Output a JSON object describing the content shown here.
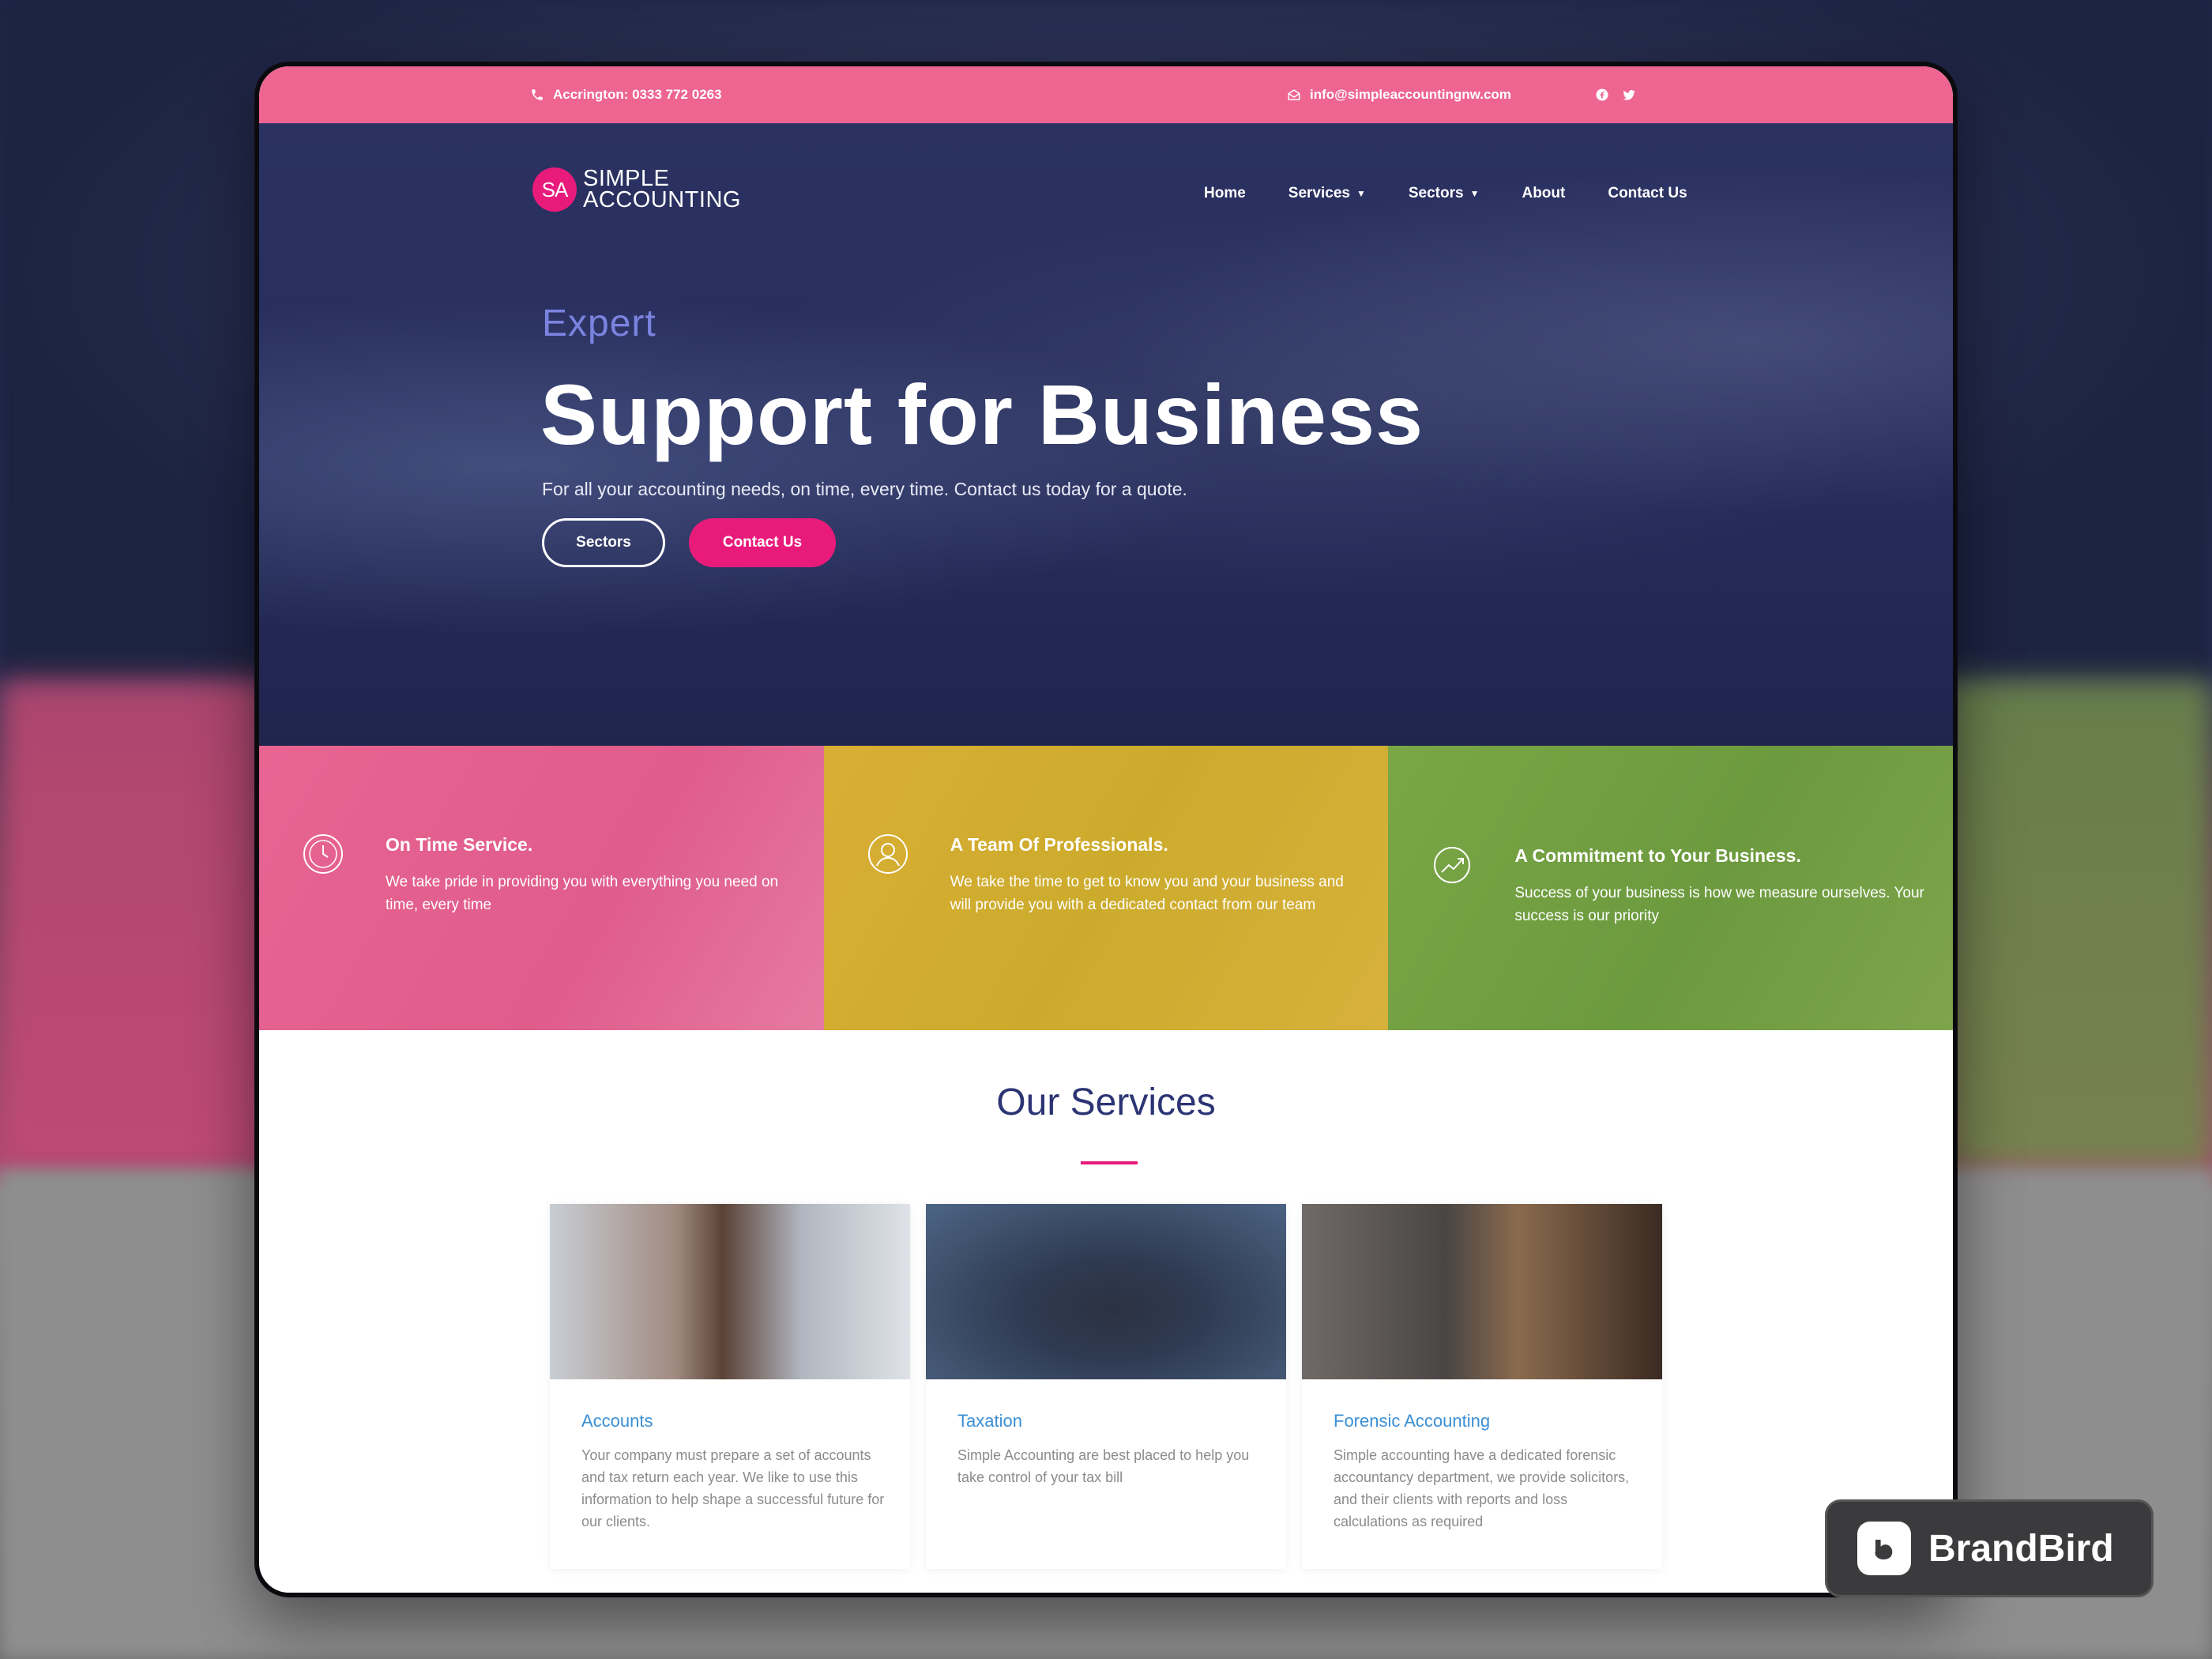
{
  "topbar": {
    "phone": "Accrington: 0333 772 0263",
    "email": "info@simpleaccountingnw.com",
    "social_icons": [
      "facebook-icon",
      "twitter-icon"
    ]
  },
  "logo": {
    "badge": "SA",
    "line1": "SIMPLE",
    "line2": "ACCOUNTING"
  },
  "nav": {
    "items": [
      {
        "label": "Home",
        "dropdown": false
      },
      {
        "label": "Services",
        "dropdown": true
      },
      {
        "label": "Sectors",
        "dropdown": true
      },
      {
        "label": "About",
        "dropdown": false
      },
      {
        "label": "Contact Us",
        "dropdown": false
      }
    ]
  },
  "hero": {
    "kicker": "Expert",
    "title": "Support for Business",
    "subtitle": "For all your accounting needs, on time, every time. Contact us today for a quote.",
    "btn_outline": "Sectors",
    "btn_primary": "Contact Us"
  },
  "features": [
    {
      "title": "On Time Service.",
      "text": "We take pride in providing you with everything you need on time, every time",
      "icon": "clock-icon",
      "color": "#e86592"
    },
    {
      "title": "A Team Of Professionals.",
      "text": "We take the time to get to know you and your business and will provide you with a dedicated contact from our team",
      "icon": "user-icon",
      "color": "#d9ae34"
    },
    {
      "title": "A Commitment to Your Business.",
      "text": "Success of your business is how we measure ourselves. Your success is our priority",
      "icon": "growth-chart-icon",
      "color": "#7aa646"
    }
  ],
  "services": {
    "title": "Our Services",
    "cards": [
      {
        "title": "Accounts",
        "text": "Your company must prepare a set of accounts and tax return each year. We like to use this information to help shape a successful future for our clients."
      },
      {
        "title": "Taxation",
        "text": "Simple Accounting are best placed to help you take control of your tax bill"
      },
      {
        "title": "Forensic Accounting",
        "text": "Simple accounting have a dedicated forensic accountancy department, we provide solicitors, and their clients with reports and loss calculations as required"
      }
    ]
  },
  "watermark": {
    "label": "BrandBird"
  },
  "colors": {
    "pink": "#e81b7b",
    "topbar": "#ee6592",
    "navy": "#2c3474",
    "link_blue": "#3a8fd6"
  }
}
